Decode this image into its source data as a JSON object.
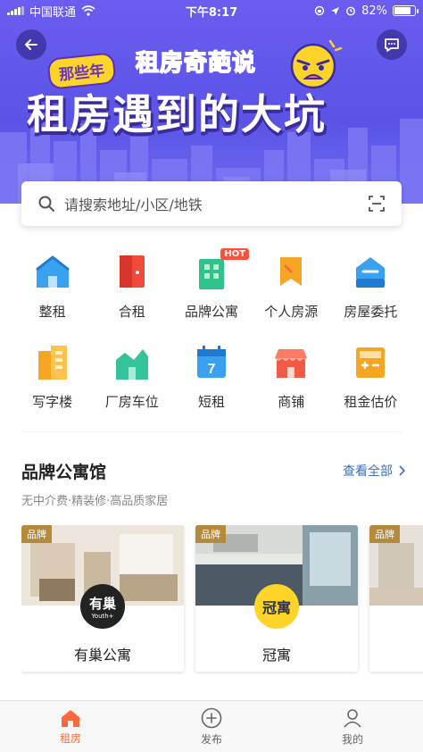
{
  "status_bar": {
    "carrier": "中国联通",
    "time": "下午8:17",
    "battery": "82%",
    "battery_level": 0.82
  },
  "banner": {
    "tag": "那些年",
    "subtitle": "租房奇葩说",
    "title": "租房遇到的大坑"
  },
  "search": {
    "placeholder": "请搜索地址/小区/地铁"
  },
  "categories": [
    {
      "label": "整租",
      "icon": "house-icon"
    },
    {
      "label": "合租",
      "icon": "door-icon"
    },
    {
      "label": "品牌公寓",
      "icon": "apartment-icon",
      "badge": "HOT"
    },
    {
      "label": "个人房源",
      "icon": "tag-icon"
    },
    {
      "label": "房屋委托",
      "icon": "delegate-house-icon"
    },
    {
      "label": "写字楼",
      "icon": "office-building-icon"
    },
    {
      "label": "厂房车位",
      "icon": "factory-icon"
    },
    {
      "label": "短租",
      "icon": "calendar-icon",
      "calendar_day": "7"
    },
    {
      "label": "商铺",
      "icon": "shop-icon"
    },
    {
      "label": "租金估价",
      "icon": "calculator-icon"
    }
  ],
  "brand_section": {
    "title": "品牌公寓馆",
    "more": "查看全部",
    "subtitle": "无中介费·精装修·高品质家居",
    "cards": [
      {
        "name": "有巢公寓",
        "tag": "品牌",
        "logo": "有巢",
        "logo_sub": "Youth+"
      },
      {
        "name": "冠寓",
        "tag": "品牌",
        "logo": "冠寓",
        "logo_sub": ""
      },
      {
        "name": "",
        "tag": "品牌",
        "logo": "",
        "logo_sub": ""
      }
    ]
  },
  "tabbar": {
    "tabs": [
      {
        "label": "租房",
        "icon": "home-icon",
        "active": true
      },
      {
        "label": "发布",
        "icon": "plus-circle-icon",
        "active": false
      },
      {
        "label": "我的",
        "icon": "user-icon",
        "active": false
      }
    ]
  },
  "colors": {
    "banner": "#6a5df0",
    "accent": "#ff6a3a",
    "link": "#3d6fbf",
    "brand_tag": "#b48a3c"
  }
}
